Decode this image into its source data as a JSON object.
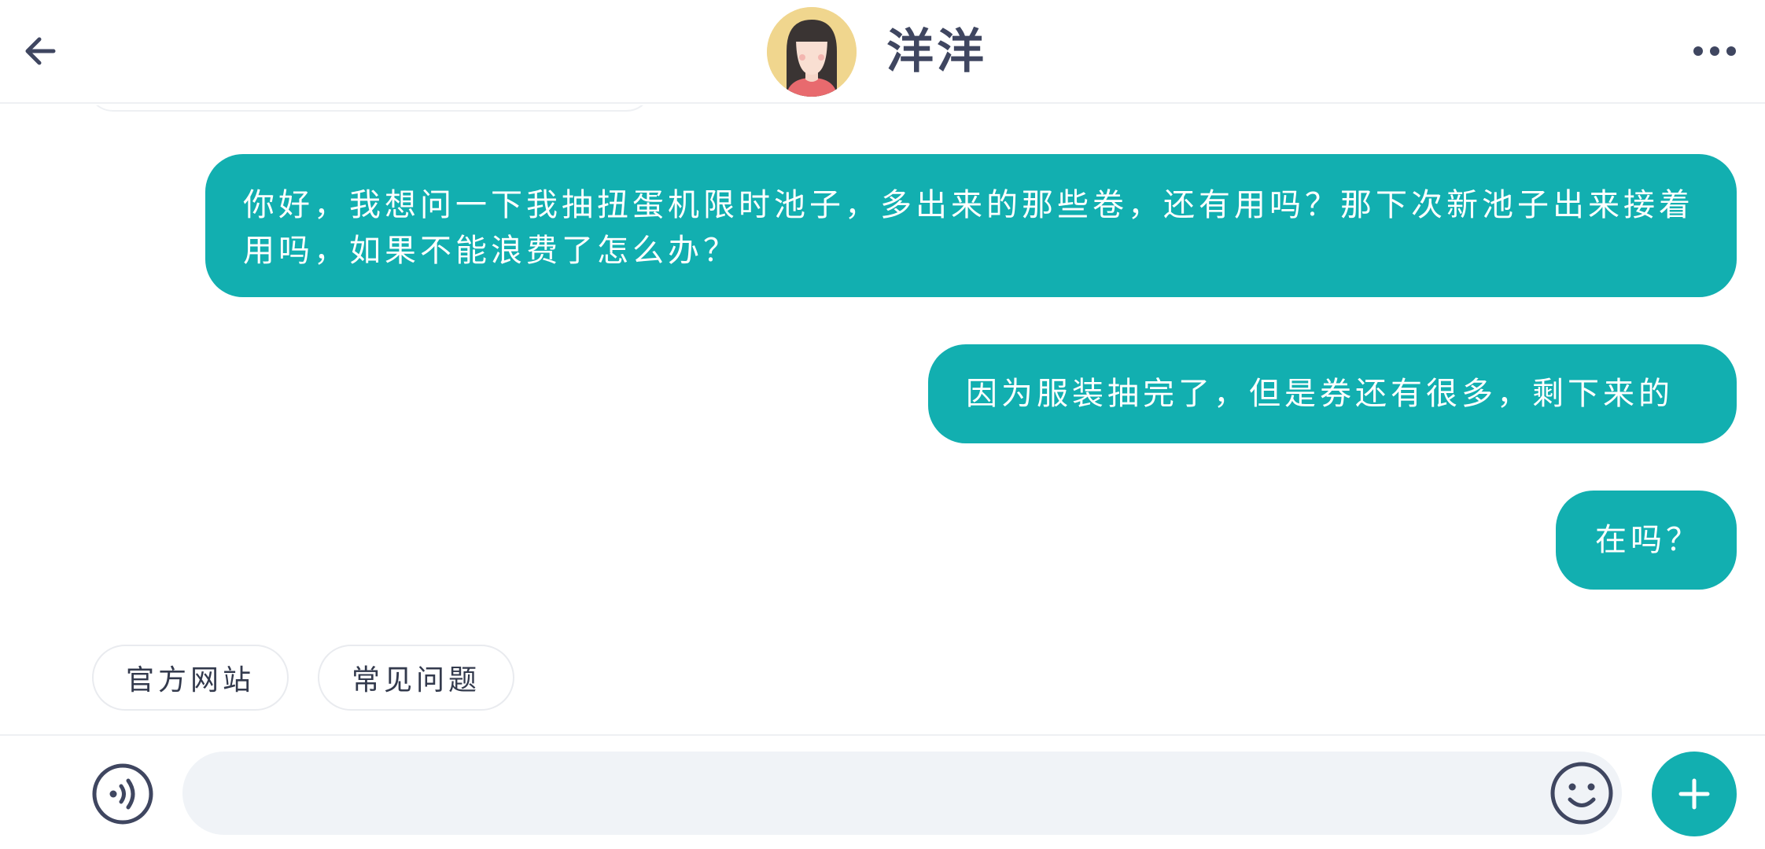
{
  "header": {
    "contact_name": "洋洋",
    "back_icon": "arrow-left-icon",
    "more_icon": "more-horizontal-icon",
    "avatar": "girl-avatar"
  },
  "messages": [
    {
      "sender": "me",
      "text": "你好，我想问一下我抽扭蛋机限时池子，多出来的那些卷，还有用吗？那下次新池子出来接着用吗，如果不能浪费了怎么办？"
    },
    {
      "sender": "me",
      "text": "因为服装抽完了，但是券还有很多，剩下来的"
    },
    {
      "sender": "me",
      "text": "在吗？"
    }
  ],
  "quick_replies": [
    {
      "label": "官方网站"
    },
    {
      "label": "常见问题"
    }
  ],
  "input_bar": {
    "message_value": "",
    "placeholder": "",
    "voice_icon": "voice-icon",
    "emoji_icon": "emoji-icon",
    "plus_icon": "plus-icon"
  },
  "colors": {
    "accent": "#12afb0",
    "title_text": "#3f4660",
    "input_background": "#f0f3f7",
    "avatar_background": "#f0d68e"
  }
}
